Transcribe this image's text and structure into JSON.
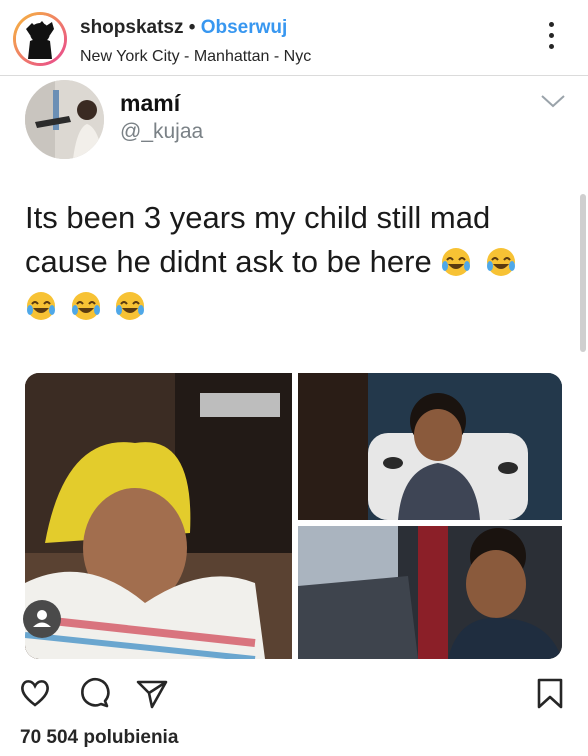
{
  "header": {
    "username": "shopskatsz",
    "separator": "•",
    "follow_label": "Obserwuj",
    "location": "New York City - Manhattan - Nyc"
  },
  "tweet": {
    "display_name": "mamí",
    "handle": "@_kujaa",
    "text_lines": [
      "Its been 3 years my child still mad",
      "cause he didnt ask to be here"
    ]
  },
  "footer": {
    "likes": "70 504 polubienia"
  },
  "icons": {
    "more": "more-vertical-icon",
    "heart": "heart-icon",
    "comment": "comment-icon",
    "share": "direct-share-icon",
    "save": "bookmark-icon",
    "user_tag": "user-tag-icon",
    "tweet_menu": "chevron-down-icon",
    "emoji": "face-with-tears-of-joy-icon"
  },
  "colors": {
    "follow_blue": "#3897f0",
    "text": "#262626",
    "handle_gray": "#7a8186"
  }
}
